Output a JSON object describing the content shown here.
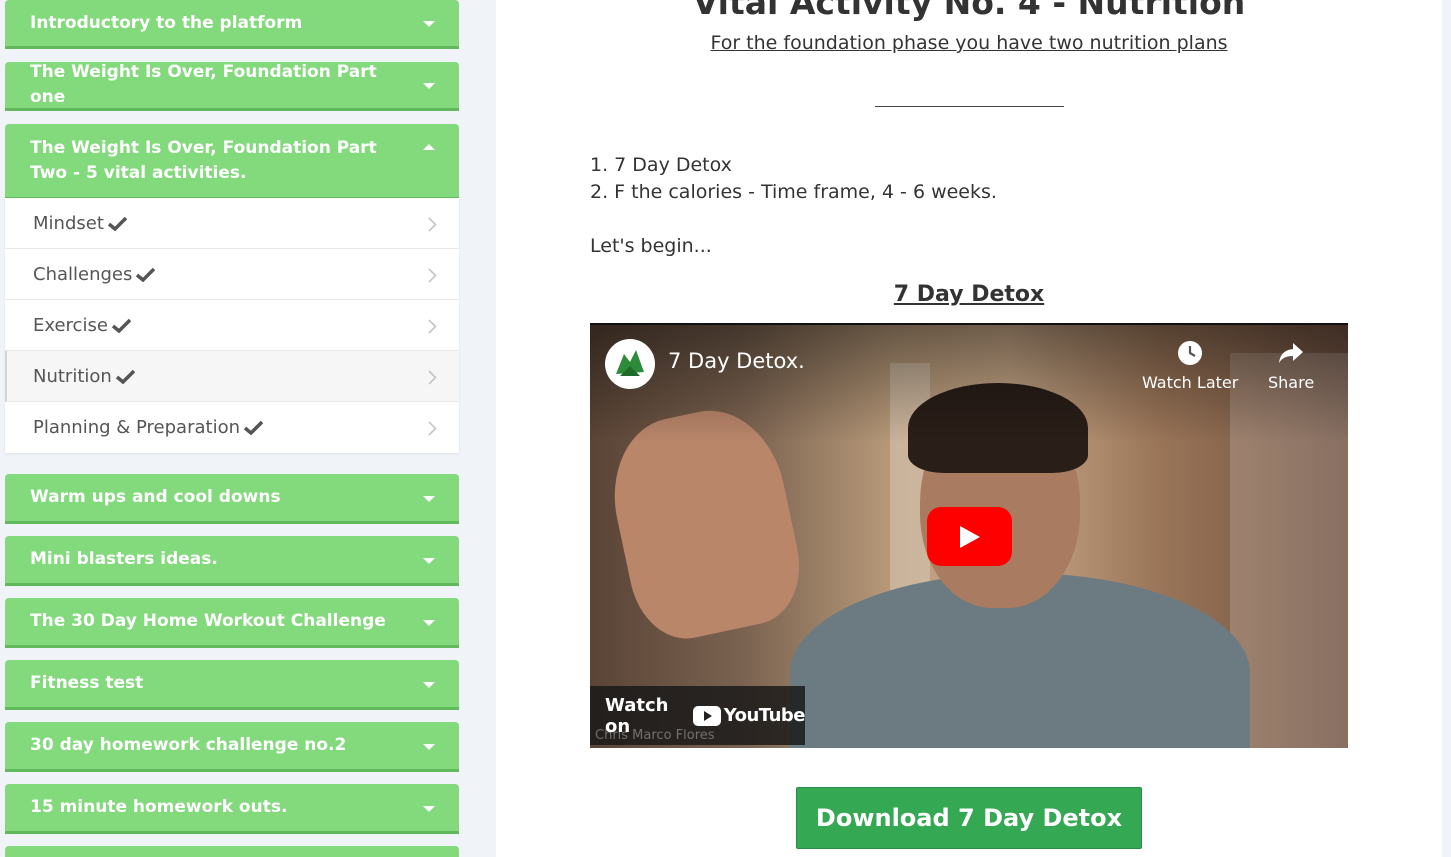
{
  "sidebar": {
    "sections": [
      {
        "title": "Introductory to the platform"
      },
      {
        "title": "The Weight Is Over, Foundation Part one"
      },
      {
        "title": "The Weight Is Over, Foundation Part Two - 5 vital activities."
      },
      {
        "title": "Warm ups and cool downs"
      },
      {
        "title": "Mini blasters ideas."
      },
      {
        "title": "The 30 Day Home Workout Challenge"
      },
      {
        "title": "Fitness test"
      },
      {
        "title": "30 day homework challenge no.2"
      },
      {
        "title": "15 minute homework outs."
      }
    ],
    "lessons": [
      {
        "label": "Mindset"
      },
      {
        "label": "Challenges"
      },
      {
        "label": "Exercise"
      },
      {
        "label": "Nutrition"
      },
      {
        "label": "Planning & Preparation"
      }
    ]
  },
  "main": {
    "title": "Vital Activity No. 4 - Nutrition",
    "subtitle": "For the foundation phase you have two nutrition plans",
    "list": [
      "1. 7 Day Detox",
      "2. F the calories - Time frame, 4 - 6 weeks."
    ],
    "intro": "Let's begin...",
    "section_title": "7 Day Detox",
    "video": {
      "title": "7 Day Detox.",
      "watch_later": "Watch Later",
      "share": "Share",
      "watch_on": "Watch on",
      "youtube": "YouTube",
      "watermark": "Chris Marco Flores"
    },
    "download_label": "Download 7 Day Detox"
  },
  "colors": {
    "section_green": "#83da7c",
    "button_green": "#34a853",
    "youtube_red": "#ff0000"
  }
}
